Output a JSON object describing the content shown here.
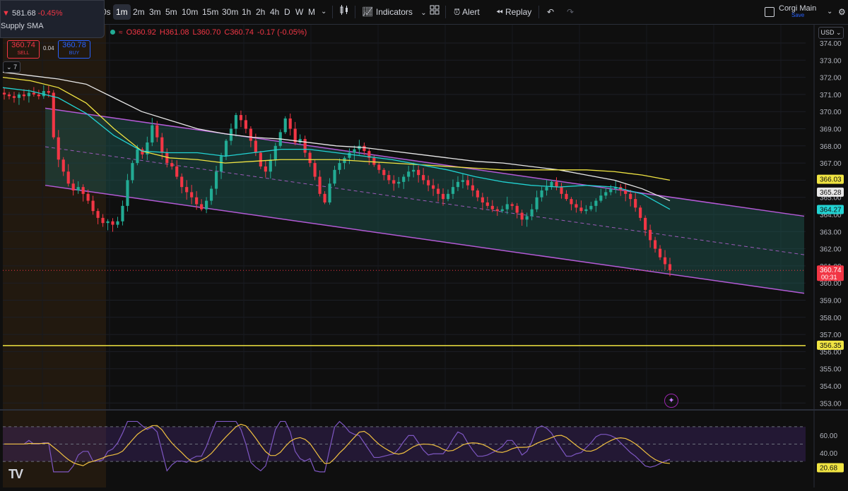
{
  "tooltip": {
    "price": "581.68",
    "change": "-0.45%",
    "label": "Supply SMA"
  },
  "toolbar": {
    "intervals": [
      "0s",
      "1m",
      "2m",
      "3m",
      "5m",
      "10m",
      "15m",
      "30m",
      "1h",
      "2h",
      "4h",
      "D",
      "W",
      "M"
    ],
    "active_interval": "1m",
    "indicators_label": "Indicators",
    "alert_label": "Alert",
    "replay_label": "Replay",
    "layout_name": "Corgi Main",
    "save_label": "Save",
    "currency": "USD"
  },
  "legend": {
    "o": "O360.92",
    "h": "H361.08",
    "l": "L360.70",
    "c": "C360.74",
    "chg": "-0.17 (-0.05%)"
  },
  "trade": {
    "sell_price": "360.74",
    "sell_label": "SELL",
    "spread": "0.04",
    "buy_price": "360.78",
    "buy_label": "BUY"
  },
  "indicator_count": "7",
  "chart_data": {
    "type": "candlestick",
    "y_axis": {
      "min": 353,
      "max": 374,
      "ticks": [
        "374.00",
        "373.00",
        "372.00",
        "371.00",
        "370.00",
        "369.00",
        "368.00",
        "367.00",
        "366.00",
        "365.00",
        "364.00",
        "363.00",
        "362.00",
        "361.00",
        "360.00",
        "359.00",
        "358.00",
        "357.00",
        "356.00",
        "355.00",
        "354.00",
        "353.00"
      ]
    },
    "price_labels": [
      {
        "value": 366.03,
        "text": "366.03",
        "color": "#f0e442"
      },
      {
        "value": 365.28,
        "text": "365.28",
        "color": "#e8e8e8"
      },
      {
        "value": 364.27,
        "text": "364.27",
        "color": "#22d3d3"
      },
      {
        "value": 360.74,
        "text": "360.74",
        "sub": "00:31",
        "color": "#f23645"
      },
      {
        "value": 356.35,
        "text": "356.35",
        "color": "#f0e442"
      }
    ],
    "horizontal_line": 356.35,
    "last_price": 360.74,
    "channel": {
      "upper_start": 370.2,
      "upper_end": 363.9,
      "lower_start": 365.7,
      "lower_end": 359.4
    },
    "rsi": {
      "ticks": [
        "60.00",
        "40.00"
      ],
      "last_value": "20.68",
      "upper": 70,
      "mid": 50,
      "lower": 30
    },
    "closes": [
      371.0,
      370.9,
      370.8,
      371.0,
      370.9,
      371.1,
      371.0,
      370.9,
      371.2,
      371.1,
      368.5,
      367.2,
      366.5,
      365.8,
      365.4,
      365.6,
      365.2,
      364.8,
      364.2,
      363.8,
      363.5,
      363.6,
      363.4,
      363.6,
      364.5,
      366.0,
      367.0,
      367.8,
      367.5,
      368.2,
      369.2,
      368.5,
      367.6,
      367.0,
      366.8,
      366.2,
      365.6,
      365.3,
      365.0,
      364.6,
      364.3,
      364.8,
      365.5,
      366.5,
      367.4,
      368.3,
      369.0,
      369.8,
      369.5,
      369.0,
      368.3,
      367.6,
      366.8,
      366.5,
      367.2,
      368.0,
      368.8,
      369.6,
      369.0,
      368.2,
      368.4,
      367.6,
      367.0,
      366.2,
      365.2,
      364.7,
      365.8,
      366.6,
      367.0,
      367.3,
      367.6,
      367.8,
      368.0,
      367.7,
      367.3,
      366.9,
      366.6,
      366.3,
      366.0,
      365.8,
      365.9,
      366.2,
      366.5,
      366.6,
      366.3,
      366.0,
      365.7,
      365.5,
      365.2,
      364.9,
      365.2,
      365.6,
      365.9,
      366.0,
      365.7,
      365.4,
      365.0,
      364.7,
      364.5,
      364.3,
      364.2,
      364.3,
      364.6,
      364.5,
      364.1,
      363.7,
      363.9,
      364.3,
      365.0,
      365.4,
      365.6,
      365.9,
      365.6,
      365.2,
      364.9,
      364.6,
      364.4,
      364.2,
      364.3,
      364.5,
      364.8,
      365.1,
      365.3,
      365.5,
      365.6,
      365.4,
      365.2,
      364.9,
      364.4,
      363.8,
      363.1,
      362.5,
      362.0,
      361.5,
      361.1,
      360.74
    ],
    "sma_white": [
      372.3,
      372.1,
      371.9,
      371.6,
      370.8,
      370.0,
      369.5,
      369.0,
      368.7,
      368.5,
      368.4,
      368.2,
      368.0,
      367.9,
      367.7,
      367.5,
      367.3,
      367.1,
      367.0,
      366.8,
      366.6,
      366.3,
      366.0,
      365.5,
      364.8
    ],
    "sma_yellow": [
      372.0,
      371.8,
      371.4,
      370.5,
      369.0,
      367.7,
      367.3,
      367.2,
      367.0,
      367.1,
      367.2,
      367.2,
      367.2,
      367.1,
      367.0,
      366.9,
      366.8,
      366.7,
      366.6,
      366.6,
      366.6,
      366.6,
      366.5,
      366.3,
      366.0
    ],
    "sma_cyan": [
      371.4,
      371.2,
      370.8,
      369.9,
      368.6,
      367.7,
      367.6,
      367.6,
      367.4,
      367.6,
      367.8,
      367.8,
      367.6,
      367.4,
      367.2,
      366.9,
      366.6,
      366.2,
      365.9,
      365.7,
      365.6,
      365.7,
      365.6,
      365.2,
      364.3
    ]
  }
}
